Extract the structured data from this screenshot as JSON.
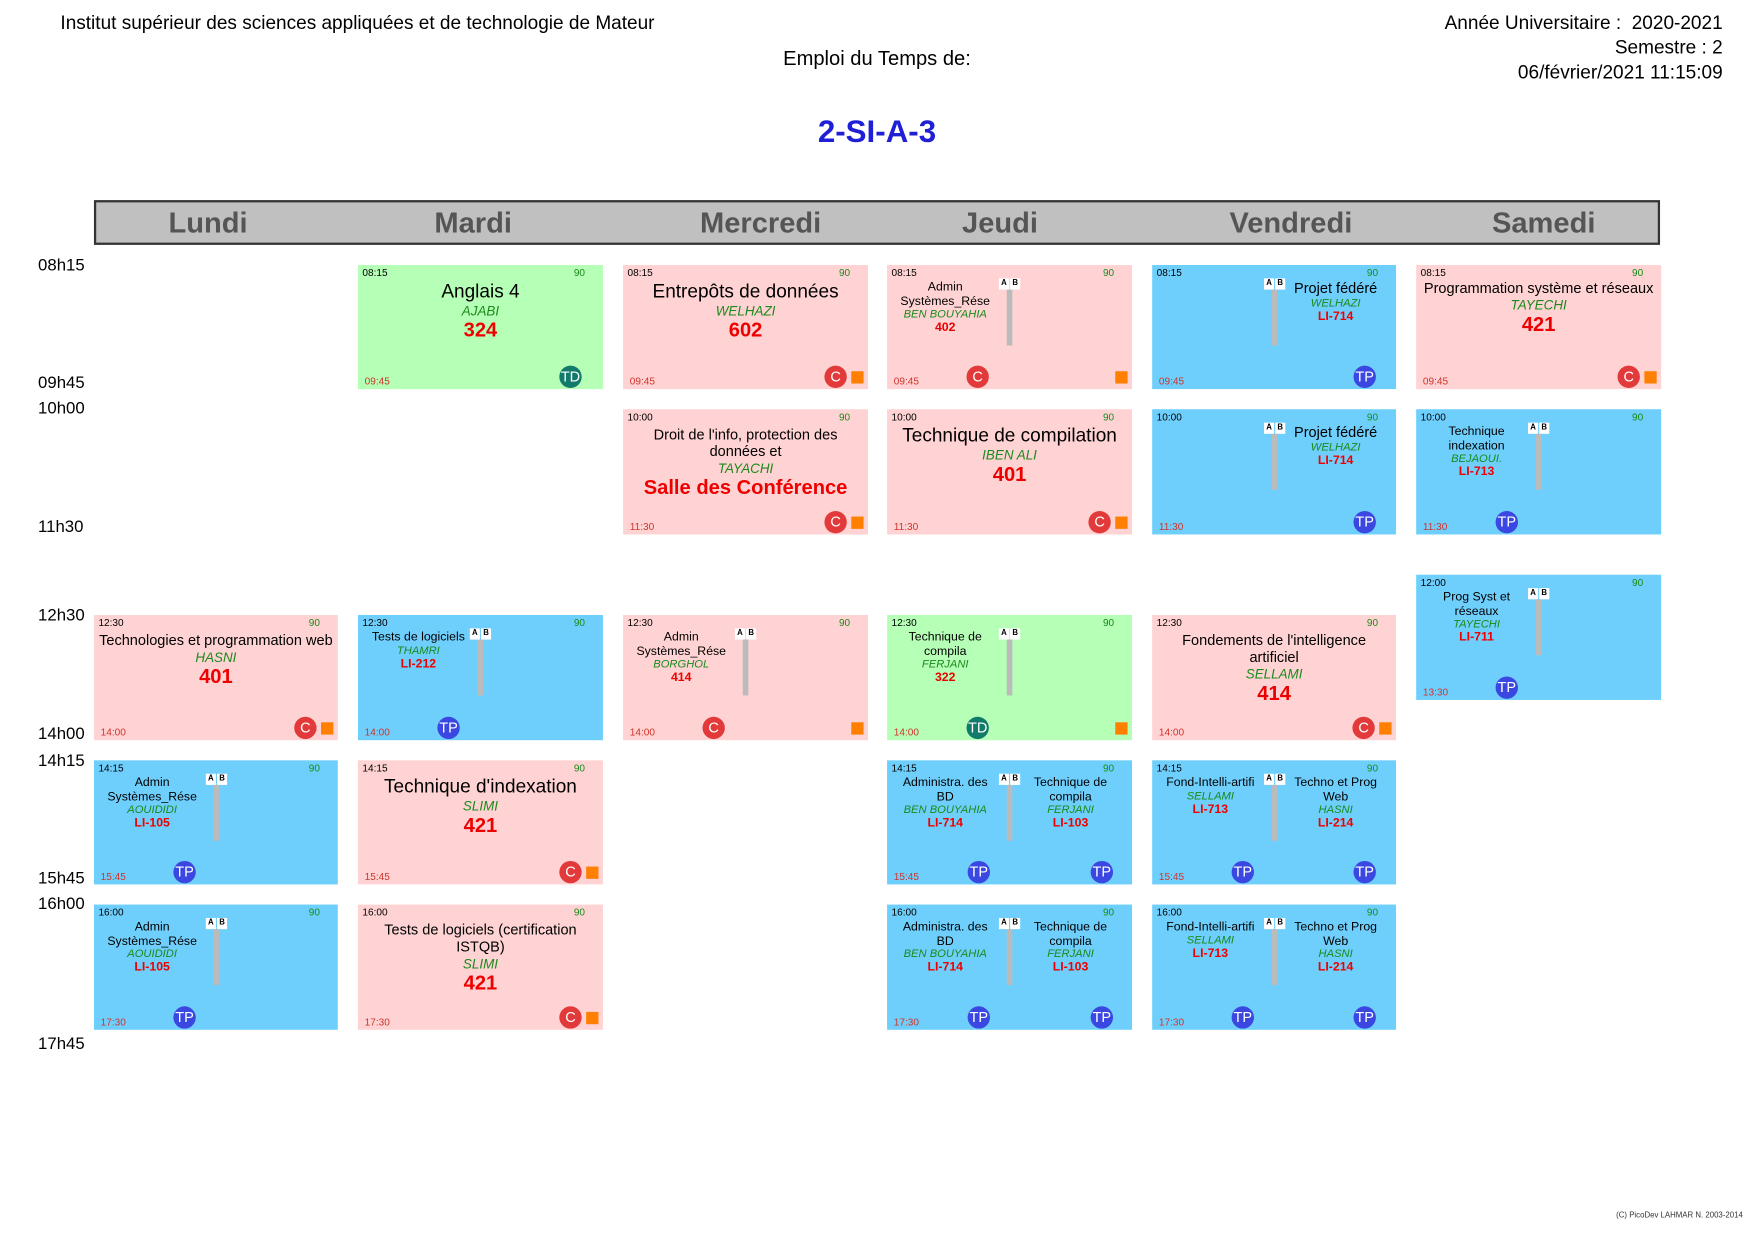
{
  "header": {
    "institute": "Institut supérieur des sciences appliquées et de technologie de Mateur",
    "year_label": "Année Universitaire :",
    "year_value": "2020-2021",
    "semester": "Semestre : 2",
    "timestamp": "06/février/2021 11:15:09",
    "title": "Emploi du Temps de:",
    "group": "2-SI-A-3"
  },
  "days": [
    "Lundi",
    "Mardi",
    "Mercredi",
    "Jeudi",
    "Vendredi",
    "Samedi"
  ],
  "times": [
    "08h15",
    "09h45",
    "10h00",
    "11h30",
    "12h30",
    "14h00",
    "14h15",
    "15h45",
    "16h00",
    "17h45"
  ],
  "footer": "(C) PicoDev LAHMAR N. 2003-2014",
  "ab_labels": {
    "a": "A",
    "b": "B"
  },
  "cards": [
    {
      "start": "08:15",
      "end": "09:45",
      "duration": "90",
      "subject": "Anglais 4",
      "teacher": "AJABI",
      "room": "324",
      "type": "TD"
    },
    {
      "start": "08:15",
      "end": "09:45",
      "duration": "90",
      "subject": "Entrepôts de données",
      "teacher": "WELHAZI",
      "room": "602",
      "type": "C"
    },
    {
      "start": "08:15",
      "end": "09:45",
      "duration": "90",
      "subject": "Admin Systèmes_Rése",
      "teacher": "BEN BOUYAHIA",
      "room": "402",
      "type": "C"
    },
    {
      "start": "08:15",
      "end": "09:45",
      "duration": "90",
      "subject": "Projet fédéré",
      "teacher": "WELHAZI",
      "room": "LI-714",
      "type": "TP"
    },
    {
      "start": "08:15",
      "end": "09:45",
      "duration": "90",
      "subject": "Programmation système et réseaux",
      "teacher": "TAYECHI",
      "room": "421",
      "type": "C"
    },
    {
      "start": "10:00",
      "end": "11:30",
      "duration": "90",
      "subject": "Droit de l'info, protection des données et",
      "teacher": "TAYACHI",
      "room": "Salle des Conférence",
      "type": "C"
    },
    {
      "start": "10:00",
      "end": "11:30",
      "duration": "90",
      "subject": "Technique de compilation",
      "teacher": "IBEN ALI",
      "room": "401",
      "type": "C"
    },
    {
      "start": "10:00",
      "end": "11:30",
      "duration": "90",
      "subject": "Projet fédéré",
      "teacher": "WELHAZI",
      "room": "LI-714",
      "type": "TP"
    },
    {
      "start": "10:00",
      "end": "11:30",
      "duration": "90",
      "subject": "Technique indexation",
      "teacher": "BEJAOUI.",
      "room": "LI-713",
      "type": "TP"
    },
    {
      "start": "12:00",
      "end": "13:30",
      "duration": "90",
      "subject": "Prog Syst et réseaux",
      "teacher": "TAYECHI",
      "room": "LI-711",
      "type": "TP"
    },
    {
      "start": "12:30",
      "end": "14:00",
      "duration": "90",
      "subject": "Technologies et programmation web",
      "teacher": "HASNI",
      "room": "401",
      "type": "C"
    },
    {
      "start": "12:30",
      "end": "14:00",
      "duration": "90",
      "subject": "Tests de logiciels",
      "teacher": "THAMRI",
      "room": "LI-212",
      "type": "TP"
    },
    {
      "start": "12:30",
      "end": "14:00",
      "duration": "90",
      "subject": "Admin Systèmes_Rése",
      "teacher": "BORGHOL",
      "room": "414",
      "type": "C"
    },
    {
      "start": "12:30",
      "end": "14:00",
      "duration": "90",
      "subject": "Technique de compila",
      "teacher": "FERJANI",
      "room": "322",
      "type": "TD"
    },
    {
      "start": "12:30",
      "end": "14:00",
      "duration": "90",
      "subject": "Fondements de l'intelligence artificiel",
      "teacher": "SELLAMI",
      "room": "414",
      "type": "C"
    },
    {
      "start": "14:15",
      "end": "15:45",
      "duration": "90",
      "subject": "Admin Systèmes_Rése",
      "teacher": "AOUIDIDI",
      "room": "LI-105",
      "type": "TP"
    },
    {
      "start": "14:15",
      "end": "15:45",
      "duration": "90",
      "subject": "Technique d'indexation",
      "teacher": "SLIMI",
      "room": "421",
      "type": "C"
    },
    {
      "start": "14:15",
      "end": "15:45",
      "duration": "90",
      "subject": "Administra. des BD",
      "teacher": "BEN BOUYAHIA",
      "room": "LI-714",
      "type": "TP",
      "subject2": "Technique de compila",
      "teacher2": "FERJANI",
      "room2": "LI-103",
      "type2": "TP"
    },
    {
      "start": "14:15",
      "end": "15:45",
      "duration": "90",
      "subject": "Fond-Intelli-artifi",
      "teacher": "SELLAMI",
      "room": "LI-713",
      "type": "TP",
      "subject2": "Techno et Prog Web",
      "teacher2": "HASNI",
      "room2": "LI-214",
      "type2": "TP"
    },
    {
      "start": "16:00",
      "end": "17:30",
      "duration": "90",
      "subject": "Admin Systèmes_Rése",
      "teacher": "AOUIDIDI",
      "room": "LI-105",
      "type": "TP"
    },
    {
      "start": "16:00",
      "end": "17:30",
      "duration": "90",
      "subject": "Tests de logiciels (certification ISTQB)",
      "teacher": "SLIMI",
      "room": "421",
      "type": "C"
    },
    {
      "start": "16:00",
      "end": "17:30",
      "duration": "90",
      "subject": "Administra. des BD",
      "teacher": "BEN BOUYAHIA",
      "room": "LI-714",
      "type": "TP",
      "subject2": "Technique de compila",
      "teacher2": "FERJANI",
      "room2": "LI-103",
      "type2": "TP"
    },
    {
      "start": "16:00",
      "end": "17:30",
      "duration": "90",
      "subject": "Fond-Intelli-artifi",
      "teacher": "SELLAMI",
      "room": "LI-713",
      "type": "TP",
      "subject2": "Techno et Prog Web",
      "teacher2": "HASNI",
      "room2": "LI-214",
      "type2": "TP"
    }
  ]
}
